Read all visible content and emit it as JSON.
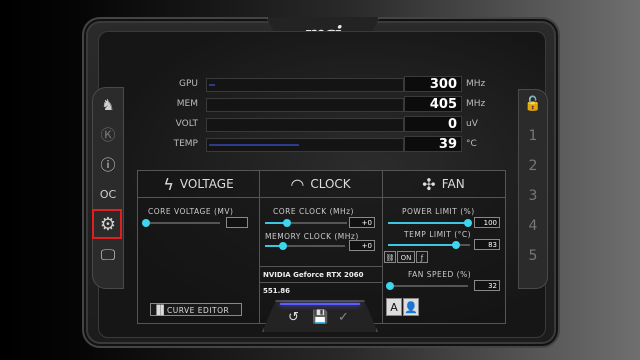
{
  "app": {
    "logo": "msi"
  },
  "window_buttons": [
    "⊞",
    "_",
    "×"
  ],
  "monitor": [
    {
      "key": "gpu",
      "label": "GPU",
      "value": "300",
      "unit": "MHz"
    },
    {
      "key": "mem",
      "label": "MEM",
      "value": "405",
      "unit": "MHz"
    },
    {
      "key": "volt",
      "label": "VOLT",
      "value": "0",
      "unit": "uV"
    },
    {
      "key": "temp",
      "label": "TEMP",
      "value": "39",
      "unit": "°C"
    }
  ],
  "left_sidebar": {
    "items": [
      {
        "name": "msi-logo-icon",
        "glyph": "♞"
      },
      {
        "name": "kombustor-icon",
        "glyph": "Ⓚ"
      },
      {
        "name": "info-icon",
        "glyph": "ⓘ"
      },
      {
        "name": "oc-scanner-icon",
        "glyph": "OC"
      },
      {
        "name": "settings-icon",
        "glyph": "⚙"
      },
      {
        "name": "monitor-icon",
        "glyph": "🖵"
      }
    ]
  },
  "right_sidebar": {
    "lock_glyph": "🔓",
    "profiles": [
      "1",
      "2",
      "3",
      "4",
      "5"
    ]
  },
  "voltage": {
    "title": "VOLTAGE",
    "core_voltage_label": "CORE VOLTAGE  (MV)",
    "core_voltage_value": "",
    "curve_editor_label": "CURVE EDITOR"
  },
  "clock": {
    "title": "CLOCK",
    "core_clock_label": "CORE CLOCK (MHz)",
    "core_clock_value": "+0",
    "memory_clock_label": "MEMORY CLOCK (MHz)",
    "memory_clock_value": "+0",
    "gpu_name": "NVIDIA Geforce RTX 2060",
    "driver_version": "551.86"
  },
  "fan": {
    "title": "FAN",
    "power_limit_label": "POWER LIMIT (%)",
    "power_limit_value": "100",
    "temp_limit_label": "TEMP LIMIT (°C)",
    "temp_limit_value": "83",
    "link_toggle_label": "ON",
    "fan_speed_label": "FAN SPEED (%)",
    "fan_speed_value": "32",
    "auto_label": "A"
  },
  "bottom_actions": [
    {
      "name": "reset-icon",
      "glyph": "↺"
    },
    {
      "name": "save-icon",
      "glyph": "💾"
    },
    {
      "name": "apply-icon",
      "glyph": "✓"
    }
  ],
  "colors": {
    "accent": "#3cd6ee",
    "selection": "#e02020",
    "glow": "#5a5cff"
  }
}
